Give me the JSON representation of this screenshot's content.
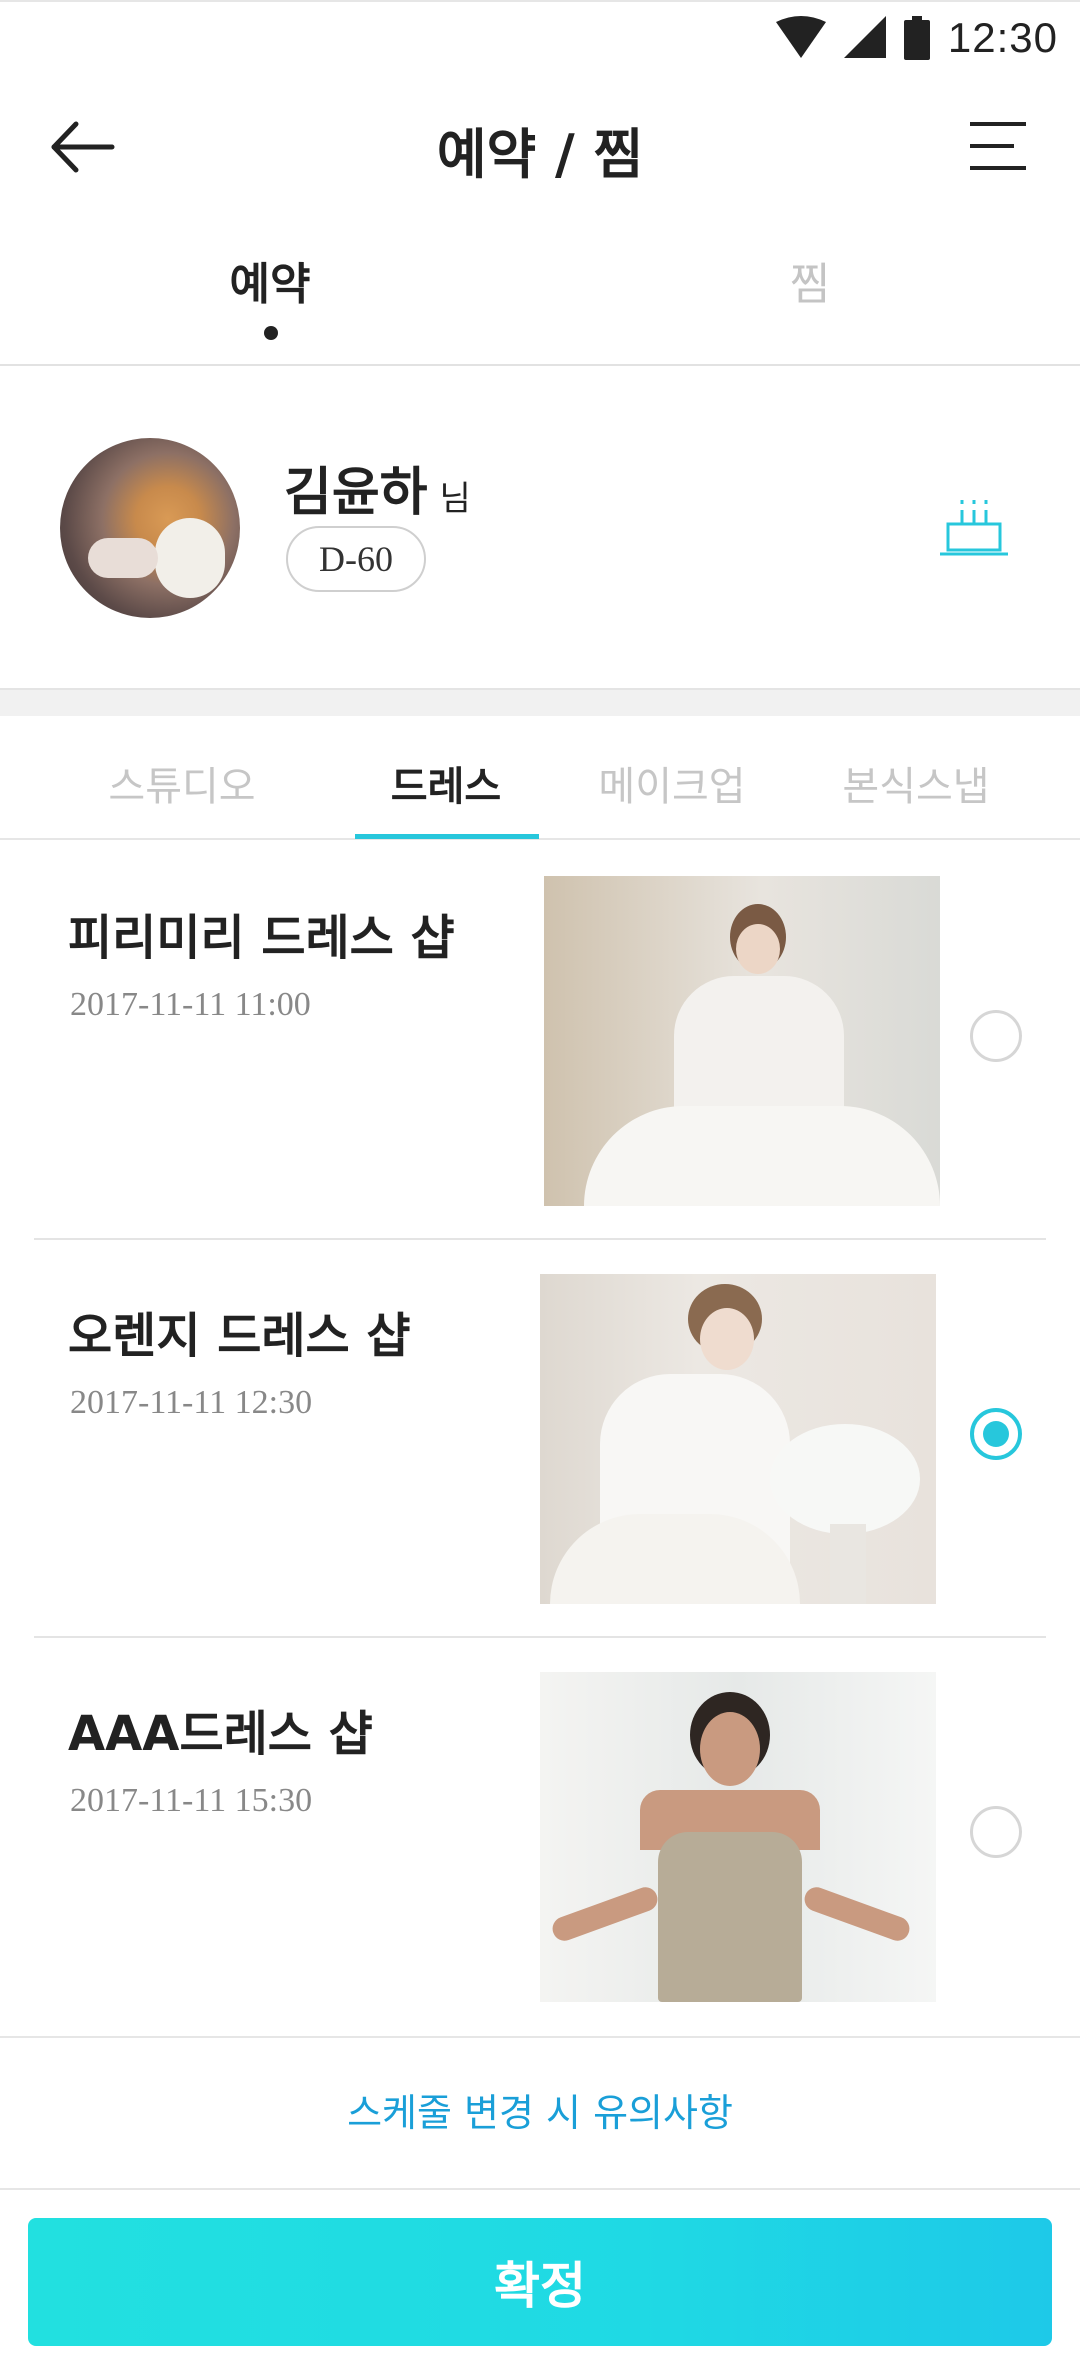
{
  "status_bar": {
    "time": "12:30"
  },
  "app_bar": {
    "title": "예약 / 찜"
  },
  "top_tabs": [
    {
      "label": "예약",
      "active": true
    },
    {
      "label": "찜",
      "active": false
    }
  ],
  "profile": {
    "name": "김윤하",
    "suffix": "님",
    "dday": "D-60"
  },
  "category_tabs": [
    {
      "label": "스튜디오",
      "active": false
    },
    {
      "label": "드레스",
      "active": true
    },
    {
      "label": "메이크업",
      "active": false
    },
    {
      "label": "본식스냅",
      "active": false
    }
  ],
  "shops": [
    {
      "name": "피리미리 드레스 샵",
      "datetime": "2017-11-11 11:00",
      "selected": false
    },
    {
      "name": "오렌지 드레스 샵",
      "datetime": "2017-11-11 12:30",
      "selected": true
    },
    {
      "name": "AAA드레스 샵",
      "datetime": "2017-11-11 15:30",
      "selected": false
    }
  ],
  "notice": {
    "label": "스케줄 변경 시 유의사항"
  },
  "confirm": {
    "label": "확정"
  },
  "colors": {
    "accent": "#27c7dc",
    "link": "#1a9fd8",
    "confirm_start": "#22e0e0",
    "confirm_end": "#1ec9e8"
  },
  "icons": [
    "wifi-icon",
    "signal-icon",
    "battery-icon",
    "back-arrow-icon",
    "menu-icon",
    "cake-icon"
  ]
}
